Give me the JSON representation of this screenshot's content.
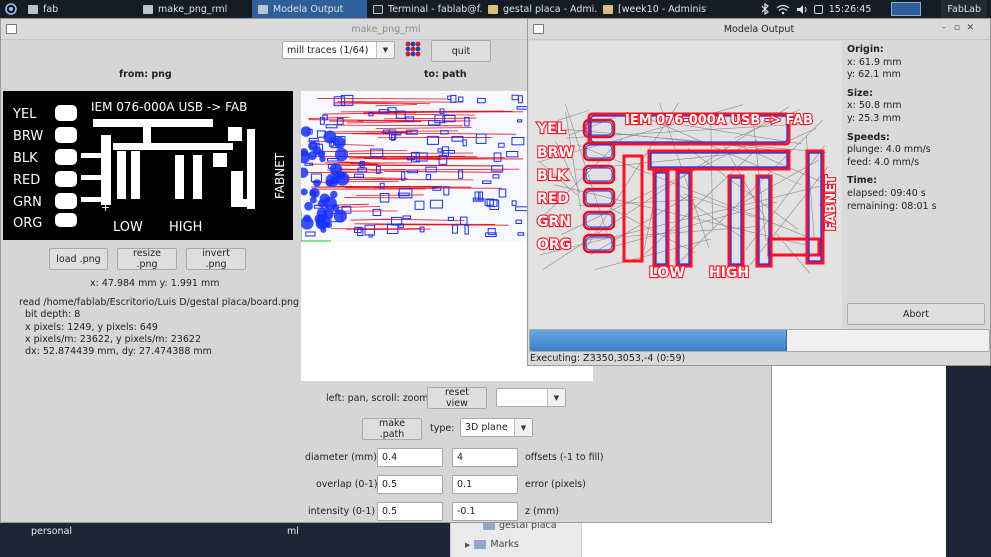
{
  "taskbar": {
    "tasks": [
      {
        "label": "fab",
        "icon": "window-icon"
      },
      {
        "label": "make_png_rml",
        "icon": "window-icon"
      },
      {
        "label": "Modela Output",
        "icon": "window-icon",
        "active": true
      },
      {
        "label": "Terminal - fablab@f...",
        "icon": "terminal-icon"
      },
      {
        "label": "gestal placa - Admi...",
        "icon": "folder-icon"
      },
      {
        "label": "[week10 - Administr...",
        "icon": "folder-icon"
      }
    ],
    "clock": "15:26:45",
    "user": "FabLab"
  },
  "desktop": {
    "label_left": "personal",
    "label_mid": "ml",
    "folder_1": "gestal placa",
    "folder_2": "Marks"
  },
  "main_window": {
    "title": "make_png_rml",
    "mode_select": "mill traces (1/64)",
    "quit": "quit",
    "from_title": "from: png",
    "to_title": "to: path",
    "load_png": "load .png",
    "resize_png": "resize .png",
    "invert_png": "invert .png",
    "coords": "x: 47.984 mm  y: 1.991 mm",
    "info": {
      "read": "read /home/fablab/Escritorio/Luis D/gestal placa/board.png",
      "bit_depth": "bit depth: 8",
      "pixels": "x pixels: 1249, y pixels: 649",
      "pixels_m": "x pixels/m: 23622, y pixels/m: 23622",
      "dxdy": "dx: 52.874439 mm, dy: 27.474388 mm"
    },
    "pan_hint": "left: pan, scroll: zoom",
    "reset_view": "reset view",
    "view_select": "",
    "make_path": "make .path",
    "type_label": "type:",
    "type_select": "3D plane",
    "diameter_label": "diameter (mm)",
    "diameter": "0.4",
    "offsets": "4",
    "offsets_label": "offsets (-1 to fill)",
    "overlap_label": "overlap (0-1)",
    "overlap": "0.5",
    "error": "0.1",
    "error_label": "error (pixels)",
    "intensity_label": "intensity (0-1)",
    "intensity": "0.5",
    "z": "-0.1",
    "z_label": "z (mm)"
  },
  "board": {
    "pins": [
      "YEL",
      "BRW",
      "BLK",
      "RED",
      "GRN",
      "ORG"
    ],
    "title": "IEM 076-000A  USB -> FAB",
    "low": "LOW",
    "high": "HIGH",
    "fabnet": "FABNET",
    "plus": "+"
  },
  "modela": {
    "title": "Modela Output",
    "origin_h": "Origin:",
    "origin_x": "x: 61.9 mm",
    "origin_y": "y: 62.1 mm",
    "size_h": "Size:",
    "size_x": "x: 50.8 mm",
    "size_y": "y: 25.3 mm",
    "speeds_h": "Speeds:",
    "plunge": "plunge: 4.0 mm/s",
    "feed": "feed: 4.0 mm/s",
    "time_h": "Time:",
    "elapsed": "elapsed: 09:40 s",
    "remaining": "remaining: 08:01 s",
    "abort": "Abort",
    "progress": 0.56,
    "executing": "Executing: Z3350,3053,-4 (0:59)"
  },
  "colors": {
    "taskbar": "#161c24",
    "active_task": "#2f5f98",
    "path_red": "#e8101a",
    "path_blue": "#1830ff",
    "progress": "#3b80cc"
  }
}
